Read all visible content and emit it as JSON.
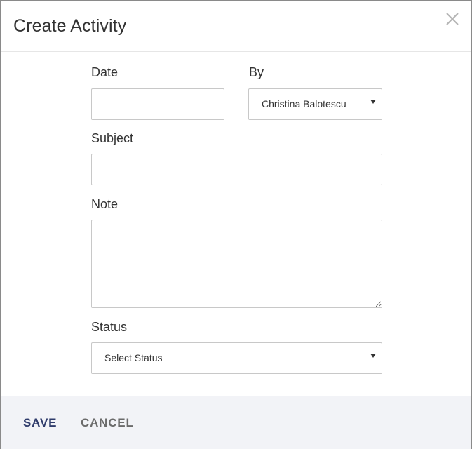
{
  "dialog": {
    "title": "Create Activity",
    "close_icon": "close-icon"
  },
  "form": {
    "date": {
      "label": "Date",
      "value": "",
      "placeholder": ""
    },
    "by": {
      "label": "By",
      "selected": "Christina Balotescu"
    },
    "subject": {
      "label": "Subject",
      "value": "",
      "placeholder": ""
    },
    "note": {
      "label": "Note",
      "value": "",
      "placeholder": ""
    },
    "status": {
      "label": "Status",
      "selected": "Select Status"
    }
  },
  "footer": {
    "save_label": "SAVE",
    "cancel_label": "CANCEL"
  },
  "colors": {
    "save": "#2f3b6b",
    "cancel": "#6b6b6b",
    "footer_bg": "#f2f3f7",
    "border": "#c8c8c8"
  }
}
